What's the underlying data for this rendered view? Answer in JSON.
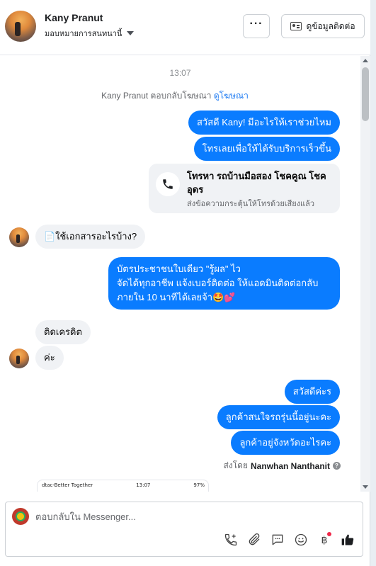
{
  "header": {
    "contact_name": "Kany Pranut",
    "assign_label": "มอบหมายการสนทนานี้",
    "more_label": "···",
    "view_contact_label": "ดูข้อมูลติดต่อ"
  },
  "thread": {
    "timestamp": "13:07",
    "ad_reply_text": "Kany Pranut ตอบกลับโฆษณา",
    "ad_link_label": "ดูโฆษณา",
    "messages": {
      "out_1": "สวัสดี Kany! มีอะไรให้เราช่วยไหม",
      "out_2": "โทรเลยเพื่อให้ได้รับบริการเร็วขึ้น",
      "call_card": {
        "title": "โทรหา รถบ้านมือสอง โชคคูณ โชคอุดร",
        "subtitle": "ส่งข้อความกระตุ้นให้โทรด้วยเสียงแล้ว"
      },
      "in_1": "📄ใช้เอกสารอะไรบ้าง?",
      "out_3_line1": "บัตรประชาชนใบเดียว \"รู้ผล\" ไว",
      "out_3_line2": "จัดได้ทุกอาชีพ แจ้งเบอร์ติดต่อ ให้แอดมินติดต่อกลับ",
      "out_3_line3": "ภายใน 10 นาทีได้เลยจ้า🤩💕",
      "in_2": "ติดเครดิต",
      "in_3": "ค่ะ",
      "out_4": "สวัสดีค่ะร",
      "out_5": "ลูกค้าสนใจรถรุ่นนี้อยู่นะคะ",
      "out_6": "ลูกค้าอยู่จังหวัดอะไรคะ"
    },
    "sent_by_prefix": "ส่งโดย",
    "sent_by_name": "Nanwhan Nanthanit",
    "screenshot_preview": {
      "carrier": "dtac-Better Together",
      "time": "13:07",
      "battery": "97%"
    }
  },
  "composer": {
    "placeholder": "ตอบกลับใน Messenger..."
  },
  "icons": [
    "phone-icon",
    "card-icon",
    "chevron-down-icon",
    "help-icon",
    "add-call-icon",
    "attach-icon",
    "saved-reply-icon",
    "emoji-icon",
    "payment-icon",
    "like-icon"
  ],
  "colors": {
    "outgoing_bubble": "#0a7cff",
    "incoming_bubble": "#f0f2f5",
    "link": "#1877f2",
    "notification_dot": "#f02849"
  }
}
